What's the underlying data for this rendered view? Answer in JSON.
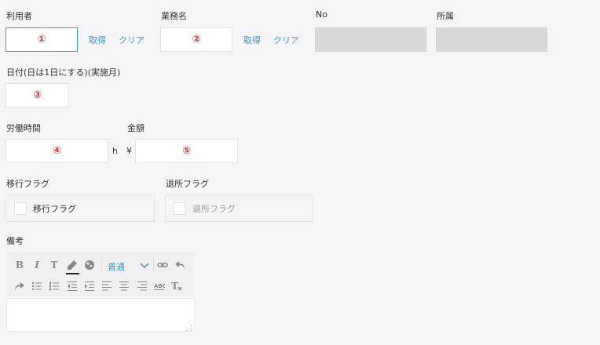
{
  "fields": {
    "user": {
      "label": "利用者",
      "value": "①",
      "fetch": "取得",
      "clear": "クリア"
    },
    "business": {
      "label": "業務名",
      "value": "②",
      "fetch": "取得",
      "clear": "クリア"
    },
    "no": {
      "label": "No",
      "value": ""
    },
    "affiliation": {
      "label": "所属",
      "value": ""
    },
    "date": {
      "label": "日付(日は1日にする)(実施月)",
      "value": "③"
    },
    "hours": {
      "label": "労働時間",
      "value": "④",
      "unit": "h"
    },
    "amount": {
      "label": "金額",
      "value": "⑤",
      "unit": "¥"
    },
    "transfer_flag": {
      "label": "移行フラグ",
      "checkbox_label": "移行フラグ",
      "checked": false
    },
    "retire_flag": {
      "label": "退所フラグ",
      "checkbox_label": "退所フラグ",
      "checked": false
    },
    "remarks": {
      "label": "備考",
      "format_select": "普通",
      "toolbar_icons": [
        "bold-icon",
        "italic-icon",
        "text-style-icon",
        "font-color-icon",
        "background-color-icon",
        "format-select",
        "link-icon",
        "undo-icon",
        "redo-icon",
        "bullet-list-icon",
        "numbered-list-icon",
        "outdent-icon",
        "indent-icon",
        "align-left-icon",
        "align-center-icon",
        "align-right-icon",
        "spell-check-icon",
        "clear-format-icon"
      ],
      "value": ""
    }
  },
  "colors": {
    "accent": "#3498db",
    "marker": "#e8312f",
    "disabled": "#d8d8d8",
    "background": "#f5f5f5"
  }
}
